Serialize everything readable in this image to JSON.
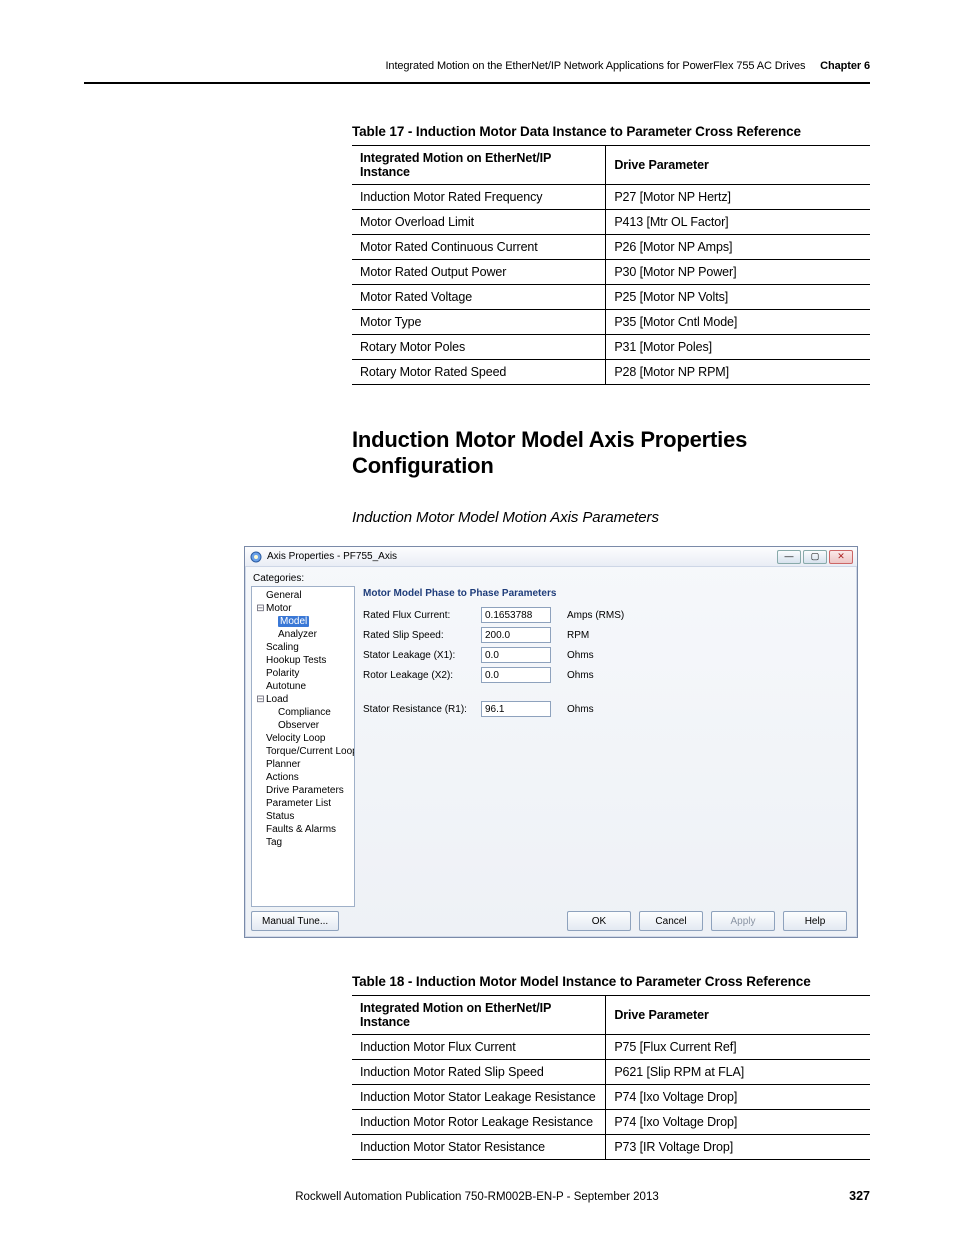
{
  "header": {
    "title_left": "Integrated Motion on the EtherNet/IP Network Applications for PowerFlex 755 AC Drives",
    "chapter": "Chapter 6"
  },
  "table17": {
    "caption": "Table 17 - Induction Motor Data Instance to Parameter Cross Reference",
    "head1": "Integrated Motion on EtherNet/IP Instance",
    "head2": "Drive Parameter",
    "rows": [
      {
        "c1": "Induction Motor Rated Frequency",
        "c2": "P27 [Motor NP Hertz]"
      },
      {
        "c1": "Motor Overload Limit",
        "c2": "P413 [Mtr OL Factor]"
      },
      {
        "c1": "Motor Rated Continuous Current",
        "c2": "P26 [Motor NP Amps]"
      },
      {
        "c1": "Motor Rated Output Power",
        "c2": "P30 [Motor NP Power]"
      },
      {
        "c1": "Motor Rated Voltage",
        "c2": "P25 [Motor NP Volts]"
      },
      {
        "c1": "Motor Type",
        "c2": "P35 [Motor Cntl Mode]"
      },
      {
        "c1": "Rotary Motor Poles",
        "c2": "P31 [Motor Poles]"
      },
      {
        "c1": "Rotary Motor Rated Speed",
        "c2": "P28 [Motor NP RPM]"
      }
    ]
  },
  "section_h2": "Induction Motor Model Axis Properties Configuration",
  "section_h3": "Induction Motor Model Motion Axis Parameters",
  "dialog": {
    "title": "Axis Properties - PF755_Axis",
    "categories_label": "Categories:",
    "tree": {
      "general": "General",
      "motor": "Motor",
      "model": "Model",
      "analyzer": "Analyzer",
      "scaling": "Scaling",
      "hookup": "Hookup Tests",
      "polarity": "Polarity",
      "autotune": "Autotune",
      "load": "Load",
      "compliance": "Compliance",
      "observer": "Observer",
      "velocity": "Velocity Loop",
      "torque": "Torque/Current Loop",
      "planner": "Planner",
      "actions": "Actions",
      "drivep": "Drive Parameters",
      "paramlist": "Parameter List",
      "status": "Status",
      "faults": "Faults & Alarms",
      "tag": "Tag"
    },
    "panel_title": "Motor Model Phase to Phase Parameters",
    "fields": {
      "flux": {
        "label": "Rated Flux Current:",
        "value": "0.1653788",
        "unit": "Amps (RMS)"
      },
      "slip": {
        "label": "Rated Slip Speed:",
        "value": "200.0",
        "unit": "RPM"
      },
      "x1": {
        "label": "Stator Leakage (X1):",
        "value": "0.0",
        "unit": "Ohms"
      },
      "x2": {
        "label": "Rotor Leakage (X2):",
        "value": "0.0",
        "unit": "Ohms"
      },
      "r1": {
        "label": "Stator Resistance (R1):",
        "value": "96.1",
        "unit": "Ohms"
      }
    },
    "buttons": {
      "manual_tune": "Manual Tune...",
      "ok": "OK",
      "cancel": "Cancel",
      "apply": "Apply",
      "help": "Help"
    }
  },
  "table18": {
    "caption": "Table 18 - Induction Motor Model Instance to Parameter Cross Reference",
    "head1": "Integrated Motion on EtherNet/IP Instance",
    "head2": "Drive Parameter",
    "rows": [
      {
        "c1": "Induction Motor Flux Current",
        "c2": "P75 [Flux Current Ref]"
      },
      {
        "c1": "Induction Motor Rated Slip Speed",
        "c2": "P621 [Slip RPM at FLA]"
      },
      {
        "c1": "Induction Motor Stator Leakage Resistance",
        "c2": "P74 [Ixo Voltage Drop]"
      },
      {
        "c1": "Induction Motor Rotor Leakage Resistance",
        "c2": "P74 [Ixo Voltage Drop]"
      },
      {
        "c1": "Induction Motor Stator Resistance",
        "c2": "P73 [IR Voltage Drop]"
      }
    ]
  },
  "footer": {
    "pub": "Rockwell Automation Publication 750-RM002B-EN-P - September 2013",
    "page": "327"
  }
}
